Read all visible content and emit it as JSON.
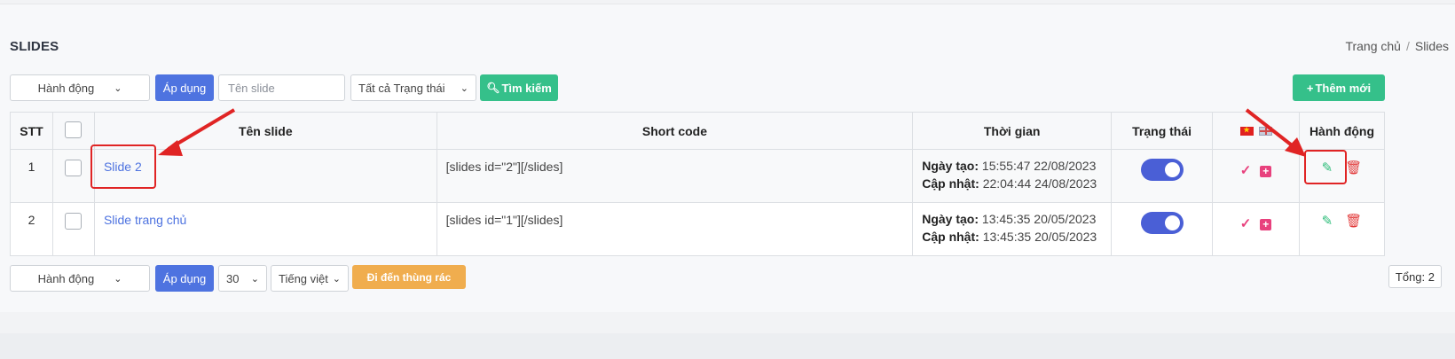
{
  "header": {
    "title": "SLIDES",
    "breadcrumb": [
      "Trang chủ",
      "Slides"
    ]
  },
  "toolbar_top": {
    "action_select": "Hành động",
    "apply_label": "Áp dụng",
    "name_placeholder": "Tên slide",
    "status_select": "Tất cả Trạng thái",
    "search_label": "Tìm kiếm",
    "add_new_label": "Thêm mới"
  },
  "table": {
    "columns": [
      "STT",
      "",
      "Tên slide",
      "Short code",
      "Thời gian",
      "Trạng thái",
      "",
      "Hành động"
    ],
    "rows": [
      {
        "stt": "1",
        "name": "Slide 2",
        "short_code": "[slides id=\"2\"][/slides]",
        "created_label": "Ngày tạo:",
        "created": "15:55:47 22/08/2023",
        "updated_label": "Cập nhật:",
        "updated": "22:04:44 24/08/2023",
        "status": "on"
      },
      {
        "stt": "2",
        "name": "Slide trang chủ",
        "short_code": "[slides id=\"1\"][/slides]",
        "created_label": "Ngày tạo:",
        "created": "13:45:35 20/05/2023",
        "updated_label": "Cập nhật:",
        "updated": "13:45:35 20/05/2023",
        "status": "on"
      }
    ]
  },
  "toolbar_bottom": {
    "action_select": "Hành động",
    "apply_label": "Áp dụng",
    "per_page": "30",
    "language": "Tiếng việt",
    "trash_label": "Đi đến thùng rác",
    "total": "Tổng: 2"
  },
  "colors": {
    "primary": "#4e73e0",
    "success": "#35c08a",
    "warning": "#f0ad4e",
    "danger": "#e23a3a",
    "accent_pink": "#e8417d",
    "annotation": "#e02424"
  },
  "icons": {
    "search": "magnifier-icon",
    "plus": "plus-icon",
    "check": "check-icon",
    "add_lang": "plus-square-icon",
    "edit": "edit-icon",
    "delete": "trash-icon"
  }
}
